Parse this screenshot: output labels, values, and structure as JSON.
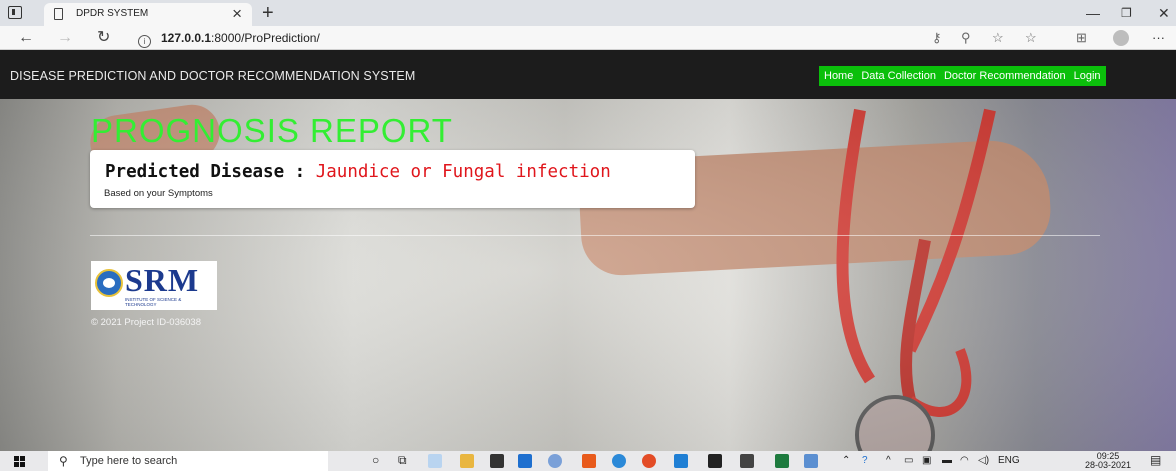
{
  "browser": {
    "tab_title": "DPDR SYSTEM",
    "tab_close": "×",
    "new_tab": "+",
    "url_host": "127.0.0.1",
    "url_rest": ":8000/ProPrediction/",
    "window_controls": [
      "—",
      "❐",
      "✕"
    ],
    "toolbar_icons": [
      "key-icon",
      "zoom-icon",
      "favorite-add-icon",
      "favorites-icon",
      "collections-icon",
      "profile-icon",
      "more-icon"
    ],
    "more": "···"
  },
  "navbar": {
    "brand": "DISEASE PREDICTION AND DOCTOR RECOMMENDATION SYSTEM",
    "links": [
      "Home",
      "Data Collection",
      "Doctor Recommendation",
      "Login"
    ]
  },
  "report": {
    "title": "PROGNOSIS REPORT",
    "label": "Predicted Disease : ",
    "disease": "Jaundice or Fungal infection",
    "subtitle": "Based on your Symptoms"
  },
  "footer": {
    "logo_text": "SRM",
    "logo_subtext": "INSTITUTE OF SCIENCE & TECHNOLOGY",
    "copyright": "© 2021 Project ID-036038"
  },
  "taskbar": {
    "search_placeholder": "Type here to search",
    "language": "ENG",
    "time": "09:25",
    "date": "28-03-2021"
  },
  "colors": {
    "accent_green": "#0bbf0b",
    "title_green": "#33ee33",
    "disease_red": "#e0161c",
    "navbar_bg": "#1c1c1c"
  }
}
